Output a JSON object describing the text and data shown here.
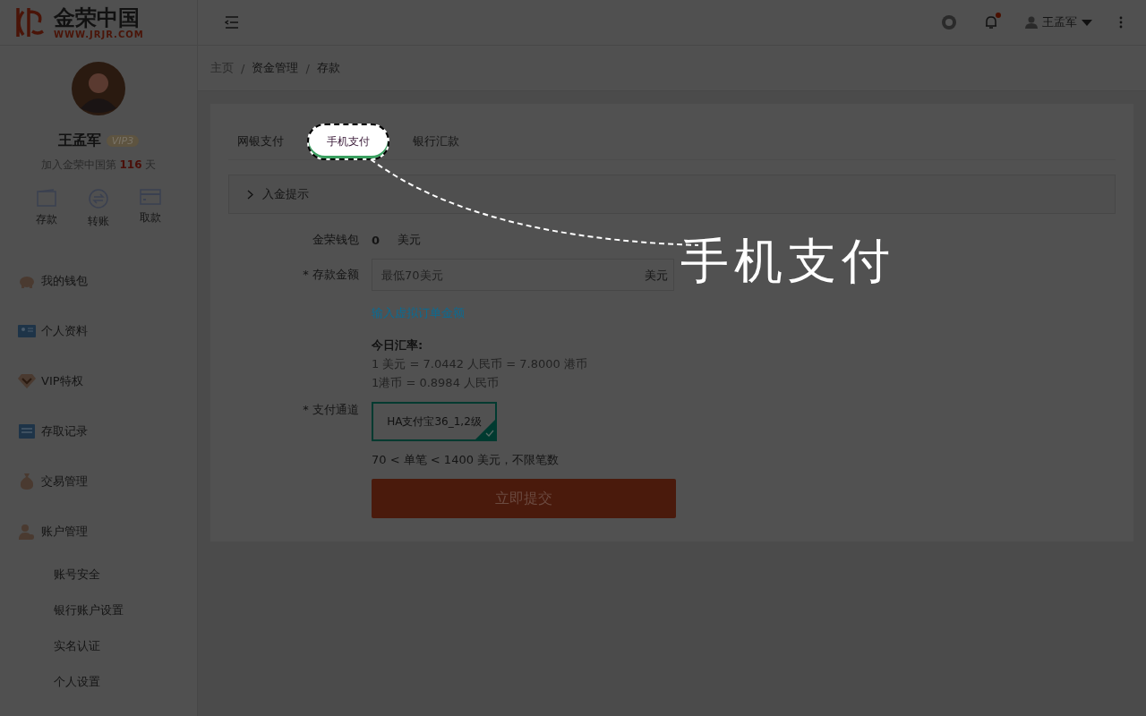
{
  "logo": {
    "name": "金荣中国",
    "url": "WWW.JRJR.COM"
  },
  "header": {
    "user": "王孟军",
    "notification_dot": true
  },
  "profile": {
    "name": "王孟军",
    "badge": "VIP3",
    "joined_prefix": "加入金荣中国第",
    "days": "116",
    "joined_suffix": "天"
  },
  "quick_actions": [
    {
      "label": "存款",
      "kind": "wallet"
    },
    {
      "label": "转账",
      "kind": "transfer"
    },
    {
      "label": "取款",
      "kind": "card"
    }
  ],
  "menu": [
    {
      "label": "我的钱包",
      "kind": "piggy"
    },
    {
      "label": "个人资料",
      "kind": "idcard"
    },
    {
      "label": "VIP特权",
      "kind": "diamond"
    },
    {
      "label": "存取记录",
      "kind": "list"
    },
    {
      "label": "交易管理",
      "kind": "moneybag"
    },
    {
      "label": "账户管理",
      "kind": "user",
      "expanded": true,
      "children": [
        {
          "label": "账号安全"
        },
        {
          "label": "银行账户设置"
        },
        {
          "label": "实名认证"
        },
        {
          "label": "个人设置"
        }
      ]
    }
  ],
  "breadcrumb": {
    "separator": "/",
    "items": [
      "主页",
      "资金管理",
      "存款"
    ]
  },
  "tabs": [
    {
      "label": "网银支付",
      "selected": false
    },
    {
      "label": "手机支付",
      "selected": true
    },
    {
      "label": "银行汇款",
      "selected": false
    }
  ],
  "notice": {
    "label": "入金提示",
    "expanded": false
  },
  "form": {
    "wallet_label": "金荣钱包",
    "wallet_value": "0",
    "wallet_unit": "美元",
    "amount_label": "* 存款金额",
    "amount_placeholder": "最低70美元",
    "amount_unit": "美元",
    "virtual_link": "输入虚拟订单金额",
    "rate_title": "今日汇率:",
    "rate_lines": [
      "1 美元 = 7.0442 人民币 = 7.8000 港币",
      "1港币 = 0.8984 人民币"
    ],
    "channel_label": "* 支付通道",
    "channels": [
      {
        "label": "HA支付宝36_1,2级",
        "selected": true
      }
    ],
    "limit": "70 < 单笔 < 1400 美元，不限笔数",
    "submit": "立即提交"
  },
  "tutorial": {
    "caption": "手机支付"
  }
}
